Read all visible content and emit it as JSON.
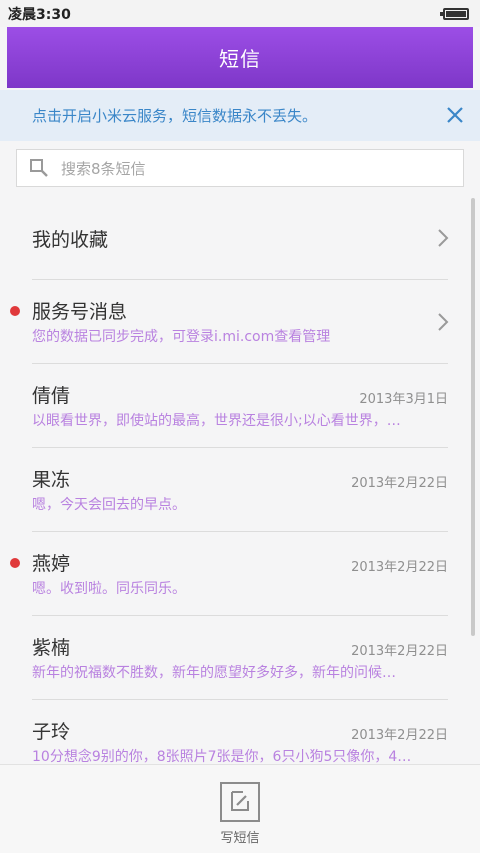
{
  "status_bar": {
    "time": "凌晨3:30",
    "battery_icon": "battery-full-icon"
  },
  "header": {
    "title": "短信"
  },
  "notice": {
    "text": "点击开启小米云服务，短信数据永不丢失。",
    "close_icon": "close-icon"
  },
  "search": {
    "placeholder": "搜索8条短信",
    "icon": "search-icon"
  },
  "favorites": {
    "label": "我的收藏"
  },
  "conversations": [
    {
      "name": "服务号消息",
      "preview": "您的数据已同步完成，可登录i.mi.com查看管理",
      "date": "",
      "unread": true
    },
    {
      "name": "倩倩",
      "preview": "以眼看世界，即使站的最高，世界还是很小;以心看世界，…",
      "date": "2013年3月1日",
      "unread": false
    },
    {
      "name": "果冻",
      "preview": "嗯，今天会回去的早点。",
      "date": "2013年2月22日",
      "unread": false
    },
    {
      "name": "燕婷",
      "preview": "嗯。收到啦。同乐同乐。",
      "date": "2013年2月22日",
      "unread": true
    },
    {
      "name": "紫楠",
      "preview": "新年的祝福数不胜数，新年的愿望好多好多，新年的问候…",
      "date": "2013年2月22日",
      "unread": false
    },
    {
      "name": "子玲",
      "preview": "10分想念9别的你，8张照片7张是你，6只小狗5只像你，4…",
      "date": "2013年2月22日",
      "unread": false
    }
  ],
  "bottom": {
    "compose_label": "写短信",
    "compose_icon": "compose-icon"
  },
  "colors": {
    "accent": "#8a42d6",
    "notice_text": "#3a86c8",
    "preview": "#b982e0",
    "unread_dot": "#e0393b"
  }
}
